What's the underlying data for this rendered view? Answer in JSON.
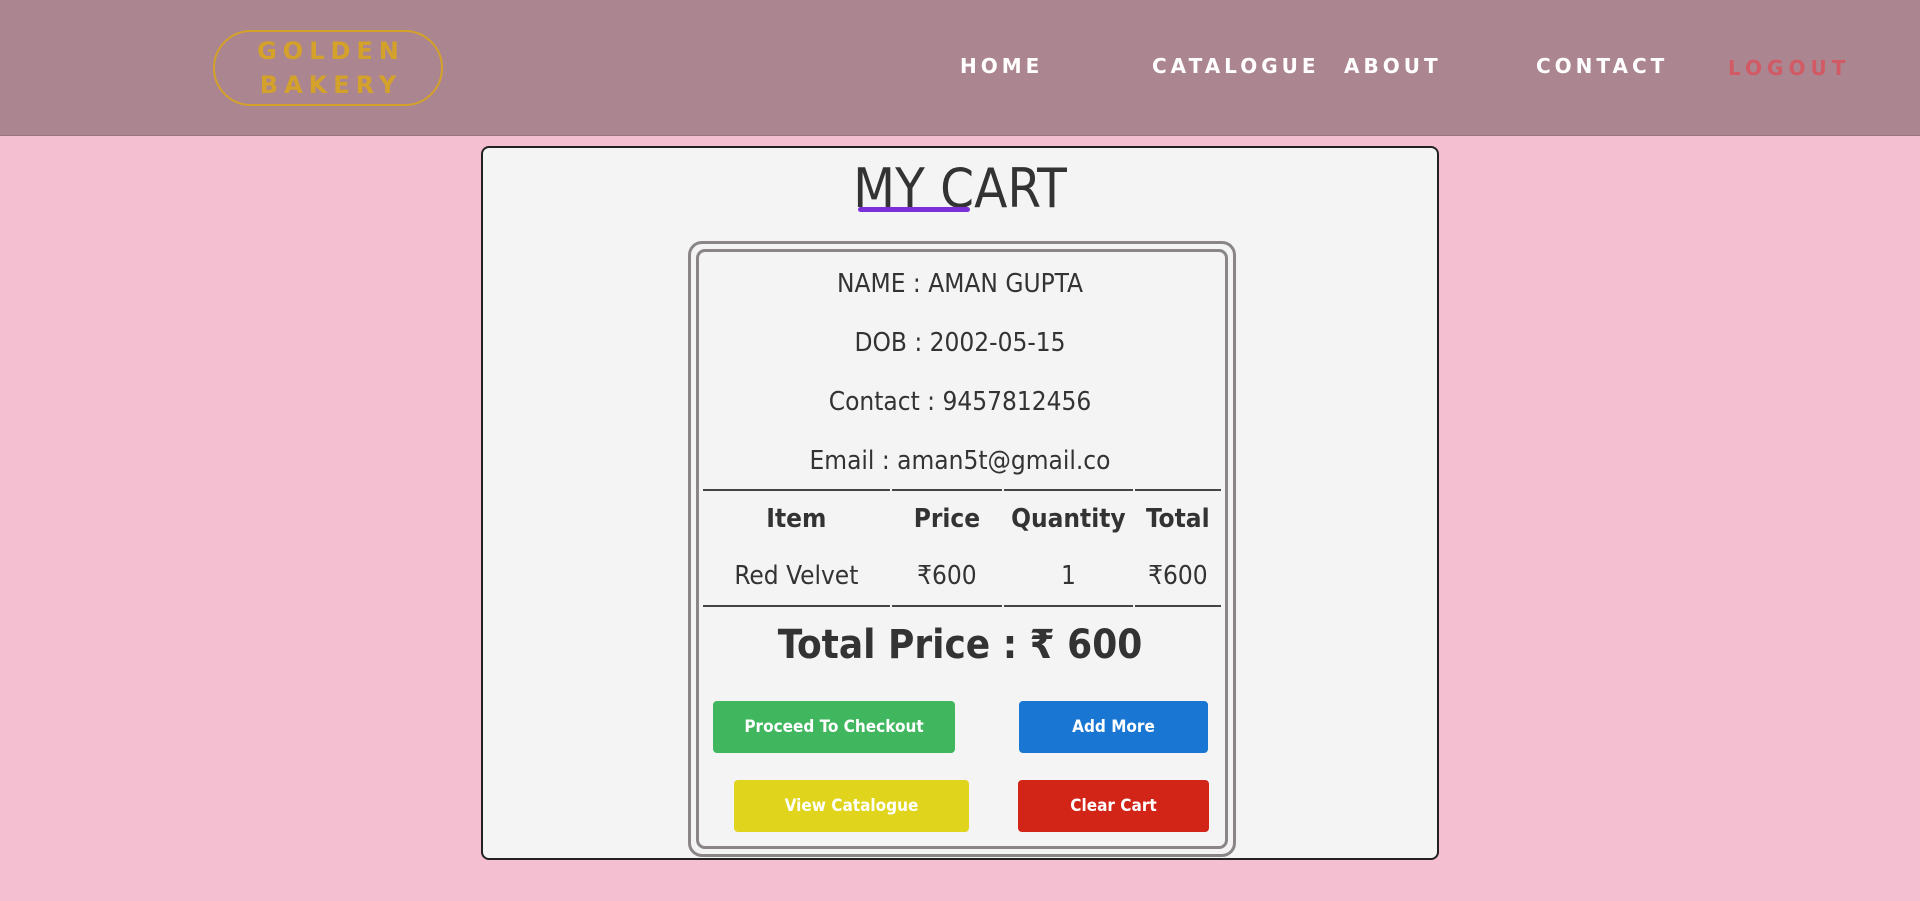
{
  "brand": {
    "line1": "GOLDEN",
    "line2": "BAKERY"
  },
  "nav": {
    "home": "HOME",
    "catalogue": "CATALOGUE",
    "about": "ABOUT",
    "contact": "CONTACT",
    "logout": "LOGOUT"
  },
  "cart": {
    "title": "MY CART",
    "customer": {
      "name": "NAME : AMAN GUPTA",
      "dob": "DOB : 2002-05-15",
      "contact": "Contact : 9457812456",
      "email": "Email : aman5t@gmail.co"
    },
    "table": {
      "headers": [
        "Item",
        "Price",
        "Quantity",
        "Total"
      ],
      "rows": [
        [
          "Red Velvet",
          "₹600",
          "1",
          "₹600"
        ]
      ]
    },
    "total_price": "Total Price : ₹ 600",
    "buttons": {
      "checkout": "Proceed To Checkout",
      "add_more": "Add More",
      "view_catalogue": "View Catalogue",
      "clear_cart": "Clear Cart"
    }
  },
  "colors": {
    "page_background": "#f4bfd0",
    "navbar_background": "#ab8590",
    "brand": "#d4a22a",
    "logout": "#d25a64",
    "title_underline": "#7b2fd6",
    "checkout_button": "#40b75e",
    "add_more_button": "#1976d2",
    "view_catalogue_button": "#e0d41c",
    "clear_cart_button": "#d32418"
  }
}
